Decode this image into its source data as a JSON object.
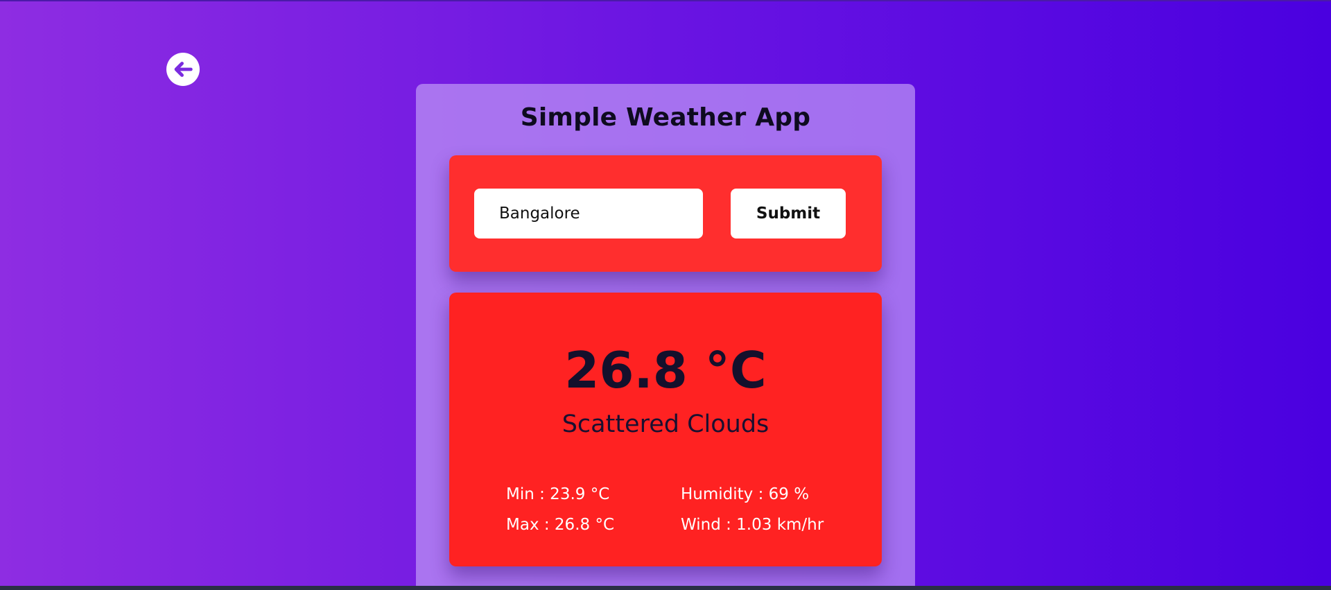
{
  "app": {
    "title": "Simple Weather App"
  },
  "search": {
    "city_value": "Bangalore",
    "submit_label": "Submit"
  },
  "weather": {
    "temperature": "26.8 °C",
    "condition": "Scattered Clouds",
    "min": "Min : 23.9 °C",
    "max": "Max : 26.8 °C",
    "humidity": "Humidity : 69 %",
    "wind": "Wind : 1.03 km/hr"
  },
  "icons": {
    "back": "arrow-left-circle-icon"
  },
  "colors": {
    "accent_card": "#ff2222",
    "search_card": "#ff2e2e",
    "icon_color": "#7a2be0",
    "gradient_start": "#8e2de2",
    "gradient_end": "#4a00e0"
  }
}
